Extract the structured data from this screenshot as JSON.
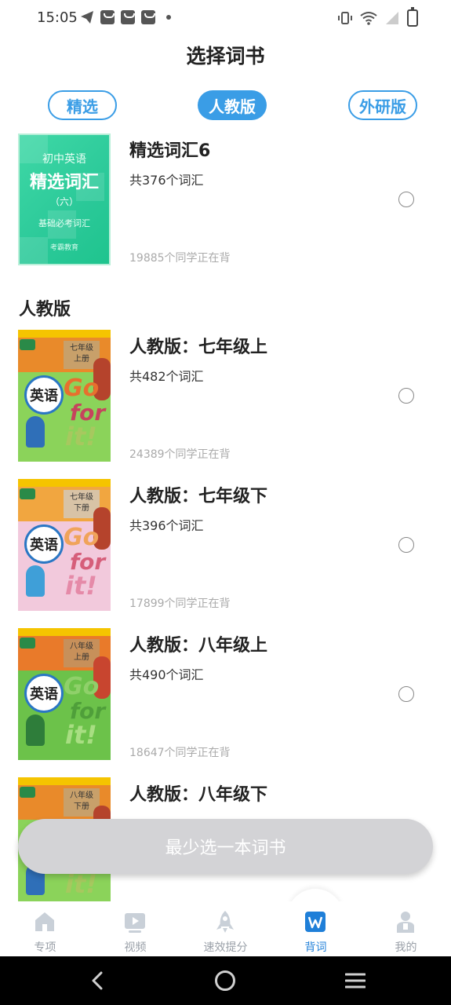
{
  "status_bar": {
    "time": "15:05"
  },
  "header": {
    "title": "选择词书"
  },
  "tabs": [
    {
      "label": "精选",
      "active": false
    },
    {
      "label": "人教版",
      "active": true
    },
    {
      "label": "外研版",
      "active": false
    }
  ],
  "featured_book": {
    "title": "精选词汇6",
    "count": "共376个词汇",
    "learners": "19885个同学正在背",
    "cover": {
      "top": "初中英语",
      "main": "精选词汇",
      "sub": "（六）",
      "note": "基础必考词汇",
      "brand": "考霸教育"
    }
  },
  "section": {
    "heading": "人教版"
  },
  "books": [
    {
      "title": "人教版：七年级上",
      "count": "共482个词汇",
      "learners": "24389个同学正在背",
      "grade": "七年级",
      "term": "上册",
      "cover_color": "#8bd35a"
    },
    {
      "title": "人教版：七年级下",
      "count": "共396个词汇",
      "learners": "17899个同学正在背",
      "grade": "七年级",
      "term": "下册",
      "cover_color": "#f2c9dc"
    },
    {
      "title": "人教版：八年级上",
      "count": "共490个词汇",
      "learners": "18647个同学正在背",
      "grade": "八年级",
      "term": "上册",
      "cover_color": "#6cc24a"
    },
    {
      "title": "人教版：八年级下",
      "count": "",
      "learners": "",
      "grade": "八年级",
      "term": "下册",
      "cover_color": "#8bd35a"
    }
  ],
  "textbook_cover": {
    "subject": "英语",
    "go": "Go",
    "for": "for",
    "it": "it!"
  },
  "primary_button": {
    "label": "最少选一本词书"
  },
  "tabbar": [
    {
      "label": "专项",
      "icon": "home-icon",
      "active": false
    },
    {
      "label": "视频",
      "icon": "video-icon",
      "active": false
    },
    {
      "label": "速效提分",
      "icon": "rocket-icon",
      "active": false
    },
    {
      "label": "背词",
      "icon": "word-book-icon",
      "active": true
    },
    {
      "label": "我的",
      "icon": "profile-icon",
      "active": false
    }
  ],
  "colors": {
    "accent": "#3a9de6",
    "tab_active_label": "#1f7fd8",
    "button_disabled": "#d3d3d6"
  }
}
